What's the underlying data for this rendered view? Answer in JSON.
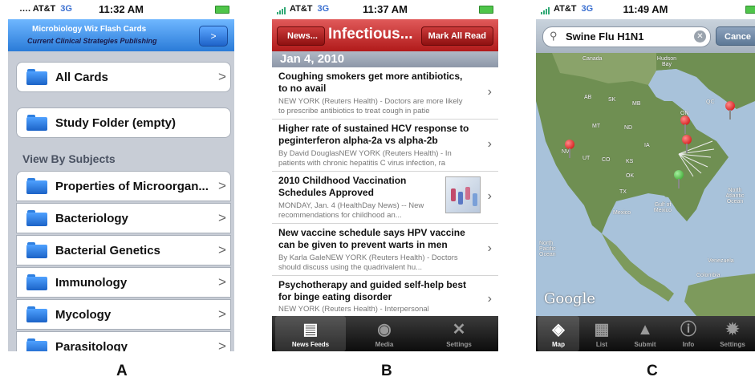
{
  "panels": {
    "a": {
      "status": {
        "carrier": "AT&T",
        "network": "3G",
        "time": "11:32 AM"
      },
      "banner": {
        "title": "Microbiology Wiz Flash Cards",
        "subtitle": "Current Clinical Strategies Publishing",
        "button": ">"
      },
      "cells": [
        {
          "label": "All Cards"
        },
        {
          "label": "Study Folder (empty)"
        }
      ],
      "section_header": "View By Subjects",
      "subjects": [
        "Properties of Microorgan...",
        "Bacteriology",
        "Bacterial Genetics",
        "Immunology",
        "Mycology",
        "Parasitology"
      ],
      "chevron": ">"
    },
    "b": {
      "status": {
        "carrier": "AT&T",
        "network": "3G",
        "time": "11:37 AM"
      },
      "nav": {
        "back": "News...",
        "title": "Infectious...",
        "action": "Mark All Read"
      },
      "date_header": "Jan 4, 2010",
      "articles": [
        {
          "headline": "Coughing smokers get more antibiotics, to no avail",
          "summary": "NEW YORK (Reuters Health) - Doctors are more likely to prescribe antibiotics to treat cough in patie"
        },
        {
          "headline": "Higher rate of sustained HCV response to peginterferon alpha-2a vs alpha-2b",
          "summary": "By David DouglasNEW YORK (Reuters Health) - In patients with chronic hepatitis C virus infection, ra"
        },
        {
          "headline": "2010 Childhood Vaccination Schedules Approved",
          "summary": "MONDAY, Jan. 4 (HealthDay News) -- New recommendations for childhood an..."
        },
        {
          "headline": "New vaccine schedule says HPV vaccine can be given to prevent warts in men",
          "summary": "By Karla GaleNEW YORK (Reuters Health) - Doctors should discuss using the quadrivalent hu..."
        },
        {
          "headline": "Psychotherapy and guided self-help best for binge eating disorder",
          "summary": "NEW YORK (Reuters Health) - Interpersonal"
        }
      ],
      "tabs": [
        {
          "label": "News Feeds",
          "icon": "newspaper-icon",
          "selected": true
        },
        {
          "label": "Media",
          "icon": "film-camera-icon",
          "selected": false
        },
        {
          "label": "Settings",
          "icon": "wrench-icon",
          "selected": false
        }
      ]
    },
    "c": {
      "status": {
        "carrier": "AT&T",
        "network": "3G",
        "time": "11:49 AM"
      },
      "search": {
        "query": "Swine Flu H1N1",
        "cancel": "Cance"
      },
      "map_labels": {
        "canada": "Canada",
        "hudson_bay": "Hudson Bay",
        "mexico": "Mexico",
        "gulf": "Gulf of Mexico",
        "north_atlantic": "North Atlantic Ocean",
        "north_pacific": "North Pacific Ocean",
        "venezuela": "Venezuela",
        "colombia": "Colombia",
        "qc": "QC",
        "on": "ON",
        "mb": "MB",
        "sk": "SK",
        "ab": "AB",
        "mt": "MT",
        "nd": "ND",
        "nv": "NV",
        "ut": "UT",
        "co": "CO",
        "ks": "KS",
        "ok": "OK",
        "tx": "TX",
        "ia": "IA"
      },
      "google_logo": "Google",
      "tabs": [
        {
          "label": "Map",
          "icon": "map-icon",
          "selected": true
        },
        {
          "label": "List",
          "icon": "list-icon",
          "selected": false
        },
        {
          "label": "Submit",
          "icon": "thumbs-up-icon",
          "selected": false
        },
        {
          "label": "Info",
          "icon": "info-icon",
          "selected": false
        },
        {
          "label": "Settings",
          "icon": "gear-icon",
          "selected": false
        }
      ]
    }
  },
  "captions": [
    "A",
    "B",
    "C"
  ]
}
